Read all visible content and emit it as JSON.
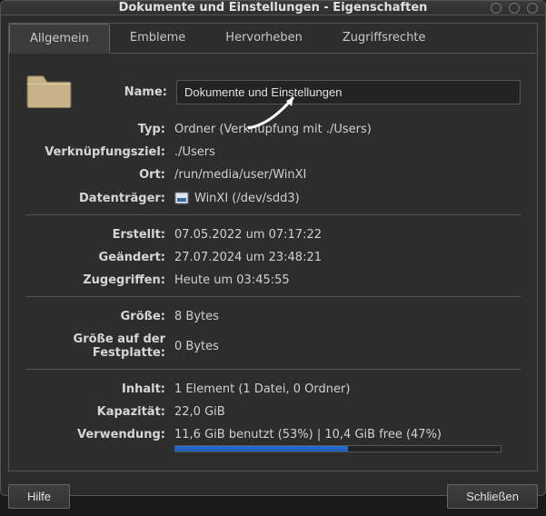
{
  "title": "Dokumente und Einstellungen - Eigenschaften",
  "tabs": [
    {
      "label": "Allgemein"
    },
    {
      "label": "Embleme"
    },
    {
      "label": "Hervorheben"
    },
    {
      "label": "Zugriffsrechte"
    }
  ],
  "fields": {
    "name_label": "Name:",
    "name_value": "Dokumente und Einstellungen",
    "type_label": "Typ:",
    "type_value": "Ordner (Verknüpfung mit ./Users)",
    "link_target_label": "Verknüpfungsziel:",
    "link_target_value": "./Users",
    "location_label": "Ort:",
    "location_value": "/run/media/user/WinXI",
    "volume_label": "Datenträger:",
    "volume_value": "WinXI (/dev/sdd3)",
    "created_label": "Erstellt:",
    "created_value": "07.05.2022 um 07:17:22",
    "modified_label": "Geändert:",
    "modified_value": "27.07.2024 um 23:48:21",
    "accessed_label": "Zugegriffen:",
    "accessed_value": "Heute um 03:45:55",
    "size_label": "Größe:",
    "size_value": "8 Bytes",
    "disk_size_label": "Größe auf der Festplatte:",
    "disk_size_value": "0 Bytes",
    "contents_label": "Inhalt:",
    "contents_value": "1 Element (1 Datei, 0 Ordner)",
    "capacity_label": "Kapazität:",
    "capacity_value": "22,0 GiB",
    "usage_label": "Verwendung:",
    "usage_value": "11,6 GiB benutzt (53%) | 10,4 GiB free (47%)",
    "usage_percent": 53
  },
  "buttons": {
    "help": "Hilfe",
    "close": "Schließen"
  }
}
